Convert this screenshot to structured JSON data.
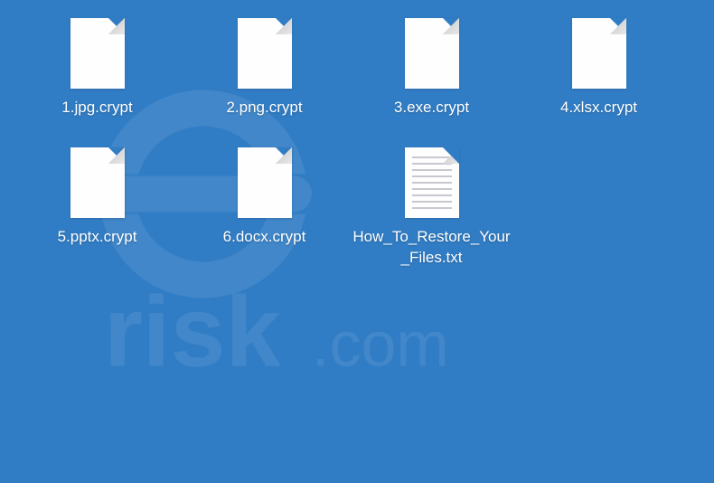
{
  "files": [
    {
      "name": "1.jpg.crypt",
      "type": "blank"
    },
    {
      "name": "2.png.crypt",
      "type": "blank"
    },
    {
      "name": "3.exe.crypt",
      "type": "blank"
    },
    {
      "name": "4.xlsx.crypt",
      "type": "blank"
    },
    {
      "name": "5.pptx.crypt",
      "type": "blank"
    },
    {
      "name": "6.docx.crypt",
      "type": "blank"
    },
    {
      "name": "How_To_Restore_Your_Files.txt",
      "type": "txt"
    }
  ],
  "watermark_text": "PCrisk.com"
}
